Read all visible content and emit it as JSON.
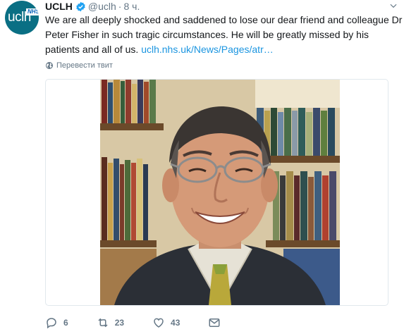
{
  "account": {
    "display_name": "UCLH",
    "handle": "@uclh",
    "separator": "·",
    "time": "8 ч.",
    "avatar_text": "uclh",
    "avatar_badge": "NHS",
    "brand_color": "#0a6f84"
  },
  "tweet": {
    "text": "We are all deeply shocked and saddened to lose our dear friend and colleague Dr Peter Fisher in such tragic circumstances. He will be greatly missed by his patients and all of us.",
    "link": "uclh.nhs.uk/News/Pages/atr…",
    "translate_label": "Перевести твит"
  },
  "actions": {
    "reply_count": "6",
    "retweet_count": "23",
    "like_count": "43"
  },
  "colors": {
    "link": "#1b95e0",
    "muted": "#657786",
    "verified": "#1da1f2"
  }
}
